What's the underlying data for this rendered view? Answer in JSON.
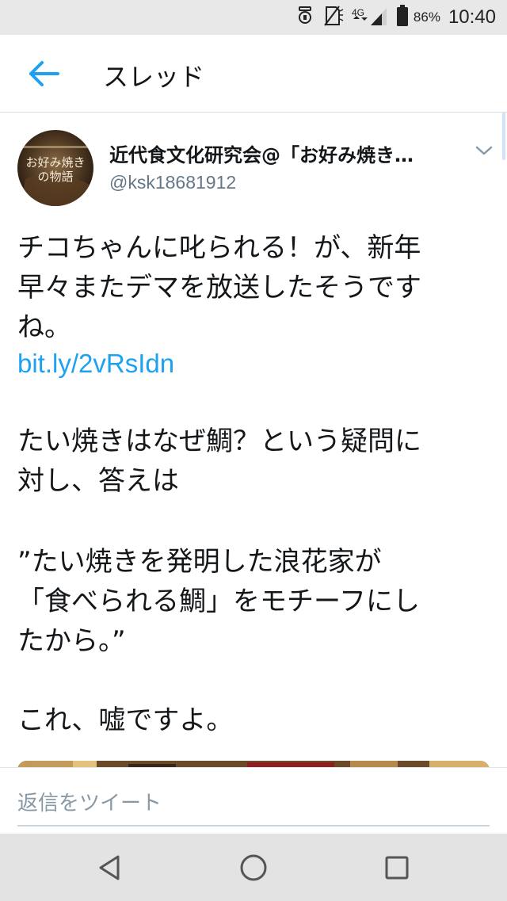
{
  "status_bar": {
    "network": "4G",
    "battery_percent": "86%",
    "time": "10:40"
  },
  "app_bar": {
    "title": "スレッド"
  },
  "tweet": {
    "author_name": "近代食文化研究会@「お好み焼き…",
    "handle": "@ksk18681912",
    "avatar_text": {
      "line1": "お好み焼き",
      "line2": "の物語"
    },
    "text": {
      "line1": "チコちゃんに叱られる！が、新年",
      "line2": "早々またデマを放送したそうです",
      "line3": "ね。",
      "link": "bit.ly/2vRsIdn",
      "line5": "たい焼きはなぜ鯛？という疑問に",
      "line6": "対し、答えは",
      "line7": "”たい焼きを発明した浪花家が",
      "line8": "「食べられる鯛」をモチーフにし",
      "line9": "たから。”",
      "line10": "これ、嘘ですよ。"
    }
  },
  "reply": {
    "placeholder": "返信をツイート"
  },
  "colors": {
    "accent": "#1da1f2",
    "secondary_text": "#657786",
    "nav_bar": "#e3e3e3",
    "status_bar": "#e8e8e8"
  },
  "icons": {
    "back": "arrow-left-icon",
    "caret": "chevron-down-icon",
    "nav_back": "triangle-back-icon",
    "nav_home": "circle-home-icon",
    "nav_recents": "square-recents-icon"
  }
}
